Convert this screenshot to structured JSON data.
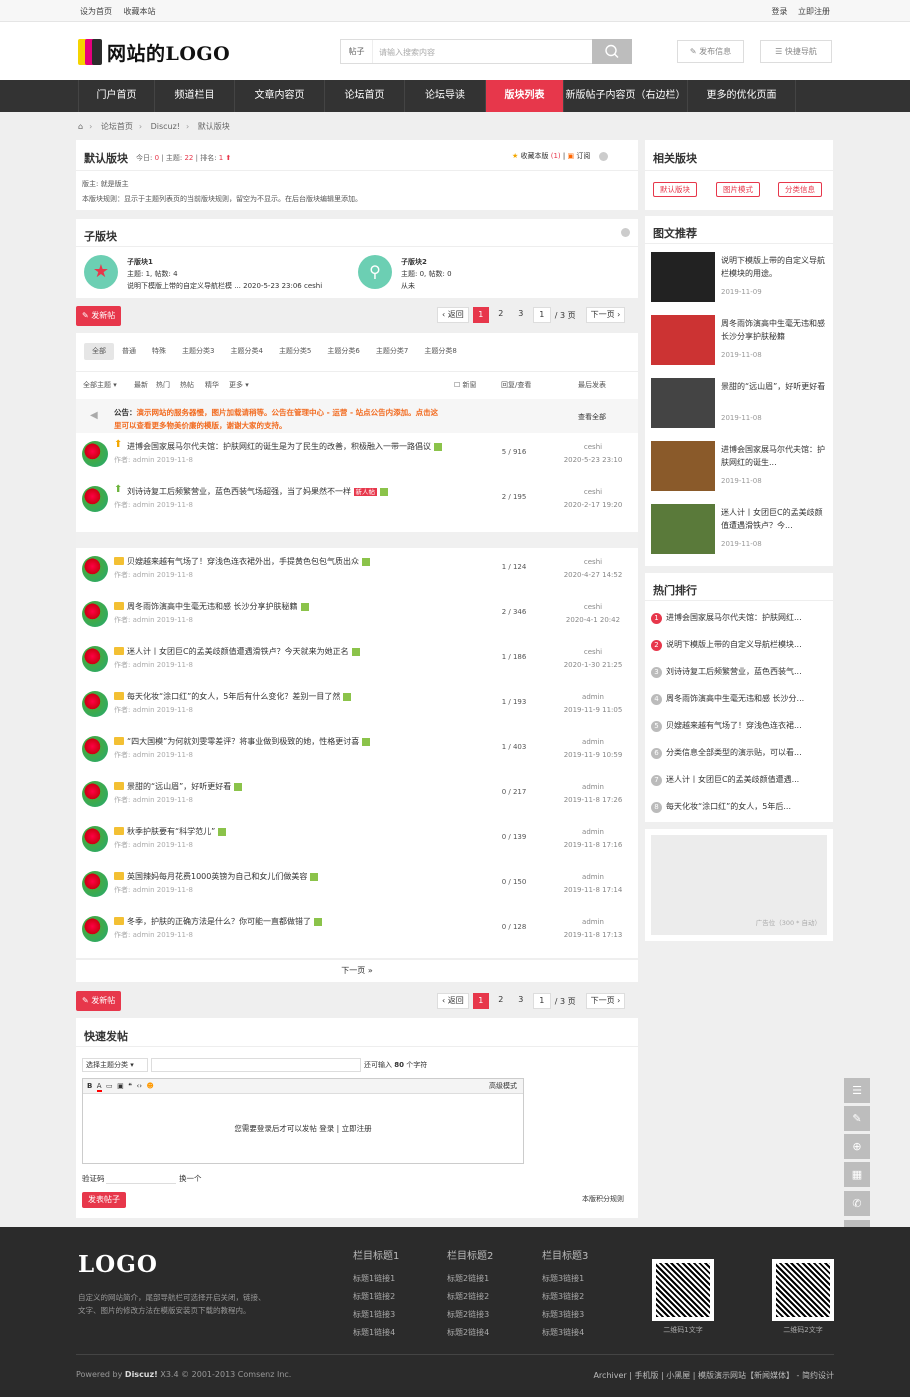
{
  "topbar": {
    "set_home": "设为首页",
    "bookmark": "收藏本站",
    "login": "登录",
    "register": "立即注册"
  },
  "header": {
    "logo_text": "网站的LOGO",
    "search_cat": "帖子",
    "search_placeholder": "请输入搜索内容",
    "post_btn": "发布信息",
    "quick_nav": "快捷导航"
  },
  "nav": [
    {
      "label": "门户首页"
    },
    {
      "label": "频道栏目"
    },
    {
      "label": "文章内容页"
    },
    {
      "label": "论坛首页"
    },
    {
      "label": "论坛导读"
    },
    {
      "label": "版块列表"
    },
    {
      "label": "新版帖子内容页（右边栏）"
    },
    {
      "label": "更多的优化页面"
    }
  ],
  "crumb": [
    "论坛首页",
    "Discuz!",
    "默认版块"
  ],
  "forum": {
    "title": "默认版块",
    "today_label": "今日:",
    "today": "0",
    "topics_label": "主题:",
    "topics": "22",
    "rank_label": "排名:",
    "rank": "1",
    "fav": "收藏本版",
    "fav_count": "(1)",
    "subscribe": "订阅",
    "moderator": "版主: 就是版主",
    "rules": "本版块规则：显示于主题列表页的当前版块规则，留空为不显示。在后台版块编辑里添加。"
  },
  "subforums": {
    "title": "子版块",
    "items": [
      {
        "name": "子版块1",
        "stats": "主题: 1, 帖数: 4",
        "last": "说明下模版上带的自定义导航栏模 ... 2020-5-23 23:06 ceshi"
      },
      {
        "name": "子版块2",
        "stats": "主题: 0, 帖数: 0",
        "last": "从未"
      }
    ]
  },
  "toolbar": {
    "new_post": "发新帖",
    "back": "返回",
    "pages": [
      "1",
      "2",
      "3"
    ],
    "page_input": "1",
    "page_total": "/ 3 页",
    "next": "下一页"
  },
  "type_tabs": [
    "全部",
    "普通",
    "特殊",
    "主题分类3",
    "主题分类4",
    "主题分类5",
    "主题分类6",
    "主题分类7",
    "主题分类8"
  ],
  "filter": {
    "all": "全部主题",
    "latest": "最新",
    "hot": "热门",
    "hot_post": "热帖",
    "digest": "精华",
    "more": "更多",
    "new_window": "新窗",
    "reply_view": "回复/查看",
    "last_post": "最后发表"
  },
  "announce": {
    "label": "公告：",
    "text1": "演示网站的服务器慢，图片加载请稍等。公告在管理中心 - 运营 - 站点公告内添加。点击这",
    "text2": "里可以查看更多物美价廉的模版，谢谢大家的支持。",
    "view_all": "查看全部"
  },
  "threads": [
    {
      "title": "进博会国家展马尔代夫馆：护肤网红的诞生是为了民生的改善，积极融入一带一路倡议",
      "meta": "作者: admin    2019-11-8",
      "count": "5  /  916",
      "user": "ceshi",
      "time": "2020-5-23 23:10"
    },
    {
      "title": "刘诗诗复工后频繁营业，蓝色西装气场超强，当了妈果然不一样",
      "badge": "新人帖",
      "meta": "作者: admin    2019-11-8",
      "count": "2  /  195",
      "user": "ceshi",
      "time": "2020-2-17 19:20"
    },
    {
      "title": "贝嫂越来越有气场了！穿浅色连衣裙外出，手提黄色包包气质出众",
      "meta": "作者: admin    2019-11-8",
      "count": "1  /  124",
      "user": "ceshi",
      "time": "2020-4-27 14:52"
    },
    {
      "title": "周冬雨饰演高中生毫无违和感 长沙分享护肤秘籍",
      "meta": "作者: admin    2019-11-8",
      "count": "2  /  346",
      "user": "ceshi",
      "time": "2020-4-1 20:42"
    },
    {
      "title": "迷人计丨女团巨C的孟美歧颜值遭遇滑铁卢？今天就来为她正名",
      "meta": "作者: admin    2019-11-8",
      "count": "1  /  186",
      "user": "ceshi",
      "time": "2020-1-30 21:25"
    },
    {
      "title": "每天化妆“涂口红”的女人，5年后有什么变化？差别一目了然",
      "meta": "作者: admin    2019-11-8",
      "count": "1  /  193",
      "user": "admin",
      "time": "2019-11-9 11:05"
    },
    {
      "title": "“四大国模”为何就刘雯零差评？将事业做到极致的她，性格更讨喜",
      "meta": "作者: admin    2019-11-8",
      "count": "1  /  403",
      "user": "admin",
      "time": "2019-11-9 10:59"
    },
    {
      "title": "景甜的“远山眉”，好听更好看",
      "meta": "作者: admin    2019-11-8",
      "count": "0  /  217",
      "user": "admin",
      "time": "2019-11-8 17:26"
    },
    {
      "title": "秋季护肤要有“科学范儿”",
      "meta": "作者: admin    2019-11-8",
      "count": "0  /  139",
      "user": "admin",
      "time": "2019-11-8 17:16"
    },
    {
      "title": "英国辣妈每月花费1000英镑为自己和女儿们做美容",
      "meta": "作者: admin    2019-11-8",
      "count": "0  /  150",
      "user": "admin",
      "time": "2019-11-8 17:14"
    },
    {
      "title": "冬季，护肤的正确方法是什么？你可能一直都做错了",
      "meta": "作者: admin    2019-11-8",
      "count": "0  /  128",
      "user": "admin",
      "time": "2019-11-8 17:13"
    }
  ],
  "next_page": "下一页 »",
  "quick_post": {
    "title": "快速发帖",
    "type_select": "选择主题分类",
    "remain_pre": "还可输入",
    "remain_num": "80",
    "remain_post": "个字符",
    "advanced": "高级模式",
    "login_tip": "您需要登录后才可以发帖 登录 | 立即注册",
    "captcha": "验证码",
    "change": "换一个",
    "submit": "发表帖子",
    "credit_rules": "本版积分规则"
  },
  "sidebar": {
    "related_title": "相关版块",
    "related": [
      "默认版块",
      "图片模式",
      "分类信息"
    ],
    "picks_title": "图文推荐",
    "picks": [
      {
        "title": "说明下模版上带的自定义导航栏模块的用途。",
        "date": "2019-11-09"
      },
      {
        "title": "周冬雨饰演高中生毫无违和感 长沙分享护肤秘籍",
        "date": "2019-11-08"
      },
      {
        "title": "景甜的“远山眉”，好听更好看",
        "date": "2019-11-08"
      },
      {
        "title": "进博会国家展马尔代夫馆：护肤网红的诞生...",
        "date": "2019-11-08"
      },
      {
        "title": "迷人计丨女团巨C的孟美歧颜值遭遇滑铁卢？今...",
        "date": "2019-11-08"
      }
    ],
    "hot_title": "热门排行",
    "hot": [
      "进博会国家展马尔代夫馆：护肤网红...",
      "说明下模版上带的自定义导航栏模块...",
      "刘诗诗复工后频繁营业，蓝色西装气...",
      "周冬雨饰演高中生毫无违和感 长沙分...",
      "贝嫂越来越有气场了！穿浅色连衣裙...",
      "分类信息全部类型的演示贴，可以看...",
      "迷人计丨女团巨C的孟美歧颜值遭遇...",
      "每天化妆“涂口红”的女人，5年后..."
    ],
    "ad": "广告位（300 * 自动）"
  },
  "footer": {
    "logo": "LOGO",
    "desc1": "自定义的网站简介，尾部导航栏可选择开启关闭，链接、",
    "desc2": "文字、图片的修改方法在模版安装页下载的教程内。",
    "cols": [
      {
        "title": "栏目标题1",
        "links": [
          "标题1链接1",
          "标题1链接2",
          "标题1链接3",
          "标题1链接4"
        ]
      },
      {
        "title": "栏目标题2",
        "links": [
          "标题2链接1",
          "标题2链接2",
          "标题2链接3",
          "标题2链接4"
        ]
      },
      {
        "title": "栏目标题3",
        "links": [
          "标题3链接1",
          "标题3链接2",
          "标题3链接3",
          "标题3链接4"
        ]
      }
    ],
    "qr1": "二维码1文字",
    "qr2": "二维码2文字",
    "powered_pre": "Powered by",
    "powered_brand": "Discuz!",
    "powered_post": "X3.4 © 2001-2013 Comsenz Inc.",
    "links": "Archiver | 手机版 | 小黑屋 | 模版演示网站【新闻媒体】 - 简约设计"
  },
  "colors": {
    "accent": "#e7374b",
    "nav_bg": "#333333",
    "footer_bg": "#2b2b2b"
  }
}
